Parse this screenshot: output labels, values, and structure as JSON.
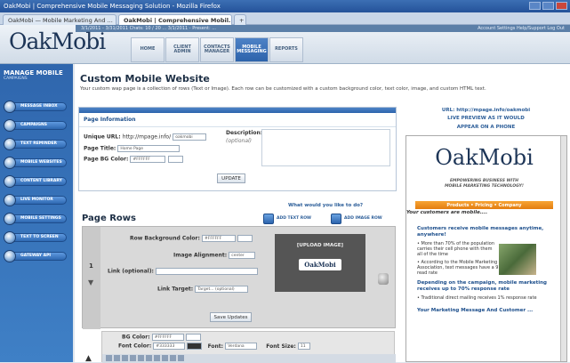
{
  "browser": {
    "title": "OakMobi | Comprehensive Mobile Messaging Solution - Mozilla Firefox",
    "tabs": [
      {
        "label": "OakMobi — Mobile Marketing And ..."
      },
      {
        "label": "OakMobi | Comprehensive Mobil...",
        "active": true
      }
    ]
  },
  "header": {
    "logo": "OakMobi",
    "strip_text": "3/1/2011 - 3/31/2011 Chats: 10 / 20 ... 3/1/2011 - Present: ...",
    "strip_links": "Account Settings  Help/Support  Log Out",
    "nav": [
      "HOME",
      "CLIENT ADMIN",
      "CONTACTS MANAGER",
      "MOBILE MESSAGING",
      "REPORTS"
    ],
    "active_nav": "MOBILE MESSAGING"
  },
  "sidebar": {
    "heading": "MANAGE MOBILE",
    "sub": "CAMPAIGNS",
    "items": [
      {
        "label": "MESSAGE INBOX",
        "icon": "inbox-icon"
      },
      {
        "label": "CAMPAIGNS",
        "icon": "campaign-icon"
      },
      {
        "label": "TEXT REMINDER",
        "icon": "calendar-icon"
      },
      {
        "label": "MOBILE WEBSITES",
        "icon": "phone-icon"
      },
      {
        "label": "CONTENT LIBRARY",
        "icon": "library-icon"
      },
      {
        "label": "LIVE MONITOR",
        "icon": "monitor-icon"
      },
      {
        "label": "MOBILE SETTINGS",
        "icon": "settings-icon"
      },
      {
        "label": "TEXT TO SCREEN",
        "icon": "screen-icon"
      },
      {
        "label": "GATEWAY API",
        "icon": "api-icon"
      }
    ]
  },
  "main": {
    "title": "Custom Mobile Website",
    "desc": "Your custom wap page is a collection of rows (Text or Image). Each row can be customized with a custom background color, text color, image, and custom HTML text.",
    "page_info": {
      "heading": "Page Information",
      "url_label": "Unique URL:",
      "url_value": "http://mpage.info/",
      "url_input": "oakmobi",
      "title_label": "Page Title:",
      "title_value": "Home Page",
      "bg_label": "Page BG Color:",
      "bg_value": "#FFFFFF",
      "desc_label": "Description:",
      "desc_value": "(optional)",
      "update_label": "UPDATE"
    },
    "page_rows": {
      "heading": "Page Rows",
      "question": "What would you like to do?",
      "add_text": "ADD TEXT ROW",
      "add_image": "ADD IMAGE ROW",
      "row_num": "1",
      "row_bg_label": "Row Background Color:",
      "row_bg_value": "#FFFFFF",
      "align_label": "Image Alignment:",
      "align_value": "center",
      "link_label": "Link (optional):",
      "target_label": "Link Target:",
      "target_value": "Target... (optional)",
      "upload": "[UPLOAD IMAGE]",
      "preview_logo": "OakMobi",
      "save_label": "Save Updates",
      "bg_color_label": "BG Color:",
      "bg_color_value": "#FFFFFF",
      "font_color_label": "Font Color:",
      "font_color_value": "#333333",
      "font_label": "Font:",
      "font_value": "Verdana",
      "size_label": "Font Size:",
      "size_value": "11"
    }
  },
  "preview": {
    "url_line": "URL: http://mpage.info/oakmobi",
    "live_line": "LIVE PREVIEW AS IT WOULD",
    "appear_line": "APPEAR ON A PHONE",
    "logo": "OakMobi",
    "tagline1": "EMPOWERING BUSINESS WITH",
    "tagline2": "MOBILE MARKETING TECHNOLOGY!",
    "nav": "Products • Pricing • Company",
    "welcome": "Your customers are mobile....",
    "h1": "Customers receive mobile messages anytime, anywhere!",
    "b1": "• More than 70% of the population carries their cell phone with them all of the time",
    "b2": "• According to the Mobile Marketing Association, text messages have a 97% read rate",
    "h2": "Depending on the campaign, mobile marketing receives up to 70% response rate",
    "b3": "• Traditional direct mailing receives 1% response rate",
    "footer": "Your Marketing Message And Customer ..."
  }
}
